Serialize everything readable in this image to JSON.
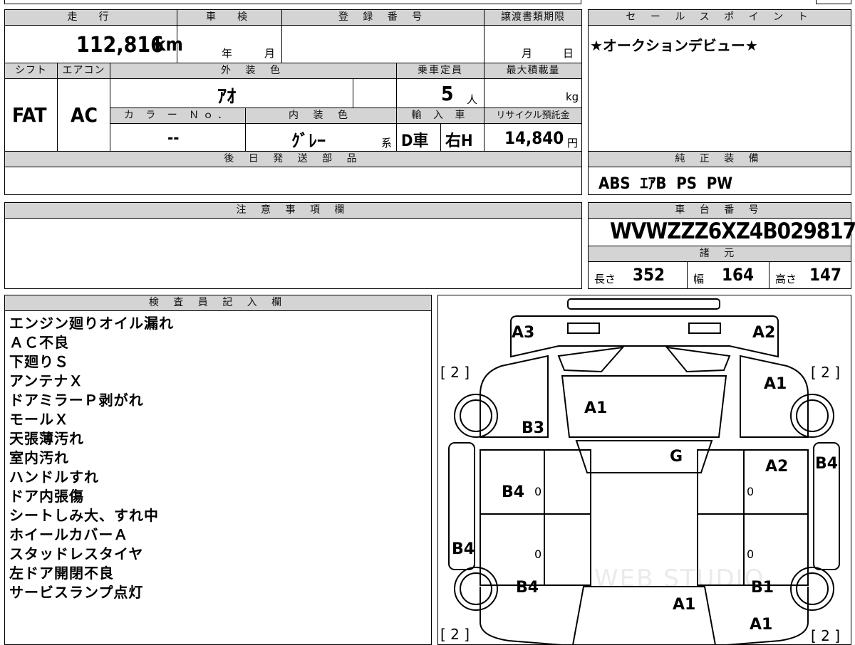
{
  "top_left": {
    "mileage_header": "走　行",
    "mileage_value": "112,816",
    "mileage_unit": "km",
    "inspection_header": "車　検",
    "inspection_year": "年",
    "inspection_month": "月",
    "registration_header": "登 録 番 号",
    "transfer_header": "譲渡書類期限",
    "transfer_month": "月",
    "transfer_day": "日",
    "shift_header": "シフト",
    "shift_value": "FAT",
    "ac_header": "エアコン",
    "ac_value": "AC",
    "exterior_header": "外 装 色",
    "exterior_value": "ｱｵ",
    "capacity_header": "乗車定員",
    "capacity_value": "5",
    "capacity_unit": "人",
    "maxload_header": "最大積載量",
    "maxload_unit": "kg",
    "colorno_header": "カ ラ ー Ｎｏ．",
    "colorno_value": "--",
    "interior_header": "内 装 色",
    "interior_value": "ｸﾞﾚｰ",
    "interior_suffix": "系",
    "import_header": "輸 入 車",
    "import_value": "D車",
    "steering_value": "右H",
    "recycle_header": "リサイクル預託金",
    "recycle_value": "14,840",
    "recycle_unit": "円",
    "later_parts_header": "後 日 発 送 部 品"
  },
  "sales_point": {
    "header": "セ ー ル ス ポ イ ン ト",
    "text": "★オークションデビュー★"
  },
  "genuine_equipment": {
    "header": "純 正 装 備",
    "text": "ABS  ｴｱB  PS  PW"
  },
  "notes": {
    "header": "注 意 事 項 欄"
  },
  "chassis": {
    "header": "車 台 番 号",
    "value": "WVWZZZ6XZ4B029817",
    "spec_header": "諸 元",
    "length_label": "長さ",
    "length_value": "352",
    "width_label": "幅",
    "width_value": "164",
    "height_label": "高さ",
    "height_value": "147"
  },
  "inspector": {
    "header": "検 査 員 記 入 欄",
    "lines": [
      "エンジン廻りオイル漏れ",
      "ＡＣ不良",
      "下廻りＳ",
      "アンテナＸ",
      "ドアミラーＰ剥がれ",
      "モールＸ",
      "天張薄汚れ",
      "室内汚れ",
      "ハンドルすれ",
      "ドア内張傷",
      "シートしみ大、すれ中",
      "ホイールカバーＡ",
      "スタッドレスタイヤ",
      "左ドア開閉不良",
      "サービスランプ点灯"
    ]
  },
  "damage_map": {
    "marks": {
      "front_left": "A3",
      "front_right": "A2",
      "hood": "A1",
      "right_fender": "A1",
      "left_fender": "B3",
      "windshield": "G",
      "right_front_door": "A2",
      "right_pillar": "B4",
      "left_front_door": "B4",
      "left_rocker": "B4",
      "left_rear_door": "B4",
      "roof_rear": "A1",
      "right_rear": "B1",
      "rear_right": "A1"
    },
    "tread_labels": {
      "fl": "[ 2 ]",
      "fr": "[ 2 ]",
      "rl": "[ 2 ]",
      "rr": "[ 2 ]"
    },
    "zeros": [
      "0",
      "0",
      "0",
      "0"
    ],
    "watermark": "WEB STUDIO"
  }
}
